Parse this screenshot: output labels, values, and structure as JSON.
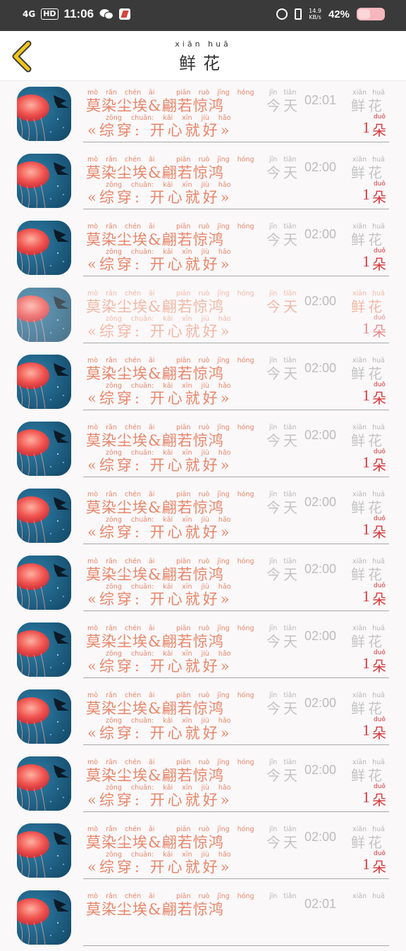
{
  "status_bar": {
    "network": "4G",
    "hd": "HD",
    "time": "11:06",
    "speed_value": "14.9",
    "speed_unit": "KB/s",
    "battery": "42%"
  },
  "header": {
    "title_pinyin": "xiān huā",
    "title": "鲜花",
    "accent_color": "#f0c51a"
  },
  "colors": {
    "name_text": "#e8866a",
    "muted_text": "#c4c4c4",
    "count_text": "#d8383c"
  },
  "rows": [
    {
      "sender_py": "mò rǎn chén āi",
      "sender": "莫染尘埃",
      "amp": "&",
      "partner_py": "piān ruò jīng hóng",
      "partner": "翩若惊鸿",
      "msg_py": "zōng chuān: kāi xīn jiù hǎo",
      "msg": "«综穿: 开心就好»",
      "day_py": "jīn tiān",
      "day": "今天",
      "time": "02:01",
      "gift_py": "xiān huā",
      "gift": "鲜花",
      "count": "1",
      "unit_py": "duǒ",
      "unit": "朵"
    },
    {
      "sender_py": "mò rǎn chén āi",
      "sender": "莫染尘埃",
      "amp": "&",
      "partner_py": "piān ruò jīng hóng",
      "partner": "翩若惊鸿",
      "msg_py": "zōng chuān: kāi xīn jiù hǎo",
      "msg": "«综穿: 开心就好»",
      "day_py": "jīn tiān",
      "day": "今天",
      "time": "02:00",
      "gift_py": "xiān huā",
      "gift": "鲜花",
      "count": "1",
      "unit_py": "duǒ",
      "unit": "朵"
    },
    {
      "sender_py": "mò rǎn chén āi",
      "sender": "莫染尘埃",
      "amp": "&",
      "partner_py": "piān ruò jīng hóng",
      "partner": "翩若惊鸿",
      "msg_py": "zōng chuān: kāi xīn jiù hǎo",
      "msg": "«综穿: 开心就好»",
      "day_py": "jīn tiān",
      "day": "今天",
      "time": "02:00",
      "gift_py": "xiān huā",
      "gift": "鲜花",
      "count": "1",
      "unit_py": "duǒ",
      "unit": "朵"
    },
    {
      "sender_py": "mò rǎn chén āi",
      "sender": "莫染尘埃",
      "amp": "&",
      "partner_py": "piān ruò jīng hóng",
      "partner": "翩若惊鸿",
      "msg_py": "zōng chuān: kāi xīn jiù hǎo",
      "msg": "«综穿: 开心就好»",
      "day_py": "jīn tiān",
      "day": "今天",
      "time": "02:00",
      "gift_py": "xiān huā",
      "gift": "鲜花",
      "count": "1",
      "unit_py": "duǒ",
      "unit": "朵",
      "faded": true
    },
    {
      "sender_py": "mò rǎn chén āi",
      "sender": "莫染尘埃",
      "amp": "&",
      "partner_py": "piān ruò jīng hóng",
      "partner": "翩若惊鸿",
      "msg_py": "zōng chuān: kāi xīn jiù hǎo",
      "msg": "«综穿: 开心就好»",
      "day_py": "jīn tiān",
      "day": "今天",
      "time": "02:00",
      "gift_py": "xiān huā",
      "gift": "鲜花",
      "count": "1",
      "unit_py": "duǒ",
      "unit": "朵"
    },
    {
      "sender_py": "mò rǎn chén āi",
      "sender": "莫染尘埃",
      "amp": "&",
      "partner_py": "piān ruò jīng hóng",
      "partner": "翩若惊鸿",
      "msg_py": "zōng chuān: kāi xīn jiù hǎo",
      "msg": "«综穿: 开心就好»",
      "day_py": "jīn tiān",
      "day": "今天",
      "time": "02:00",
      "gift_py": "xiān huā",
      "gift": "鲜花",
      "count": "1",
      "unit_py": "duǒ",
      "unit": "朵"
    },
    {
      "sender_py": "mò rǎn chén āi",
      "sender": "莫染尘埃",
      "amp": "&",
      "partner_py": "piān ruò jīng hóng",
      "partner": "翩若惊鸿",
      "msg_py": "zōng chuān: kāi xīn jiù hǎo",
      "msg": "«综穿: 开心就好»",
      "day_py": "jīn tiān",
      "day": "今天",
      "time": "02:00",
      "gift_py": "xiān huā",
      "gift": "鲜花",
      "count": "1",
      "unit_py": "duǒ",
      "unit": "朵"
    },
    {
      "sender_py": "mò rǎn chén āi",
      "sender": "莫染尘埃",
      "amp": "&",
      "partner_py": "piān ruò jīng hóng",
      "partner": "翩若惊鸿",
      "msg_py": "zōng chuān: kāi xīn jiù hǎo",
      "msg": "«综穿: 开心就好»",
      "day_py": "jīn tiān",
      "day": "今天",
      "time": "02:00",
      "gift_py": "xiān huā",
      "gift": "鲜花",
      "count": "1",
      "unit_py": "duǒ",
      "unit": "朵"
    },
    {
      "sender_py": "mò rǎn chén āi",
      "sender": "莫染尘埃",
      "amp": "&",
      "partner_py": "piān ruò jīng hóng",
      "partner": "翩若惊鸿",
      "msg_py": "zōng chuān: kāi xīn jiù hǎo",
      "msg": "«综穿: 开心就好»",
      "day_py": "jīn tiān",
      "day": "今天",
      "time": "02:00",
      "gift_py": "xiān huā",
      "gift": "鲜花",
      "count": "1",
      "unit_py": "duǒ",
      "unit": "朵"
    },
    {
      "sender_py": "mò rǎn chén āi",
      "sender": "莫染尘埃",
      "amp": "&",
      "partner_py": "piān ruò jīng hóng",
      "partner": "翩若惊鸿",
      "msg_py": "zōng chuān: kāi xīn jiù hǎo",
      "msg": "«综穿: 开心就好»",
      "day_py": "jīn tiān",
      "day": "今天",
      "time": "02:00",
      "gift_py": "xiān huā",
      "gift": "鲜花",
      "count": "1",
      "unit_py": "duǒ",
      "unit": "朵"
    },
    {
      "sender_py": "mò rǎn chén āi",
      "sender": "莫染尘埃",
      "amp": "&",
      "partner_py": "piān ruò jīng hóng",
      "partner": "翩若惊鸿",
      "msg_py": "zōng chuān: kāi xīn jiù hǎo",
      "msg": "«综穿: 开心就好»",
      "day_py": "jīn tiān",
      "day": "今天",
      "time": "02:00",
      "gift_py": "xiān huā",
      "gift": "鲜花",
      "count": "1",
      "unit_py": "duǒ",
      "unit": "朵"
    },
    {
      "sender_py": "mò rǎn chén āi",
      "sender": "莫染尘埃",
      "amp": "&",
      "partner_py": "piān ruò jīng hóng",
      "partner": "翩若惊鸿",
      "msg_py": "zōng chuān: kāi xīn jiù hǎo",
      "msg": "«综穿: 开心就好»",
      "day_py": "jīn tiān",
      "day": "今天",
      "time": "02:00",
      "gift_py": "xiān huā",
      "gift": "鲜花",
      "count": "1",
      "unit_py": "duǒ",
      "unit": "朵"
    },
    {
      "sender_py": "mò rǎn chén āi",
      "sender": "莫染尘埃",
      "amp": "&",
      "partner_py": "piān ruò jīng hóng",
      "partner": "翩若惊鸿",
      "msg_py": "",
      "msg": "",
      "day_py": "jīn tiān",
      "day": "",
      "time": "02:01",
      "gift_py": "xiān huā",
      "gift": "",
      "count": "",
      "unit_py": "",
      "unit": ""
    }
  ]
}
